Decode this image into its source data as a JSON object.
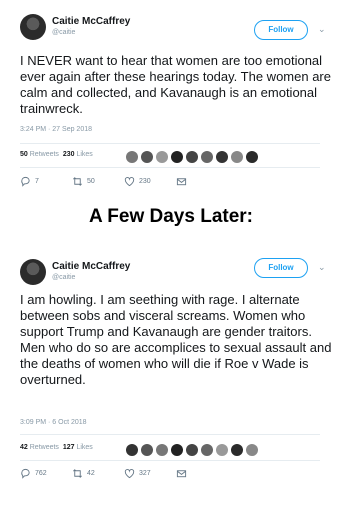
{
  "tweet1": {
    "name": "Caitie McCaffrey",
    "handle": "@caitie",
    "follow_label": "Follow",
    "text": "I NEVER want to hear that women are too emotional ever again after these hearings today.  The women are calm and collected, and Kavanaugh is an emotional trainwreck.",
    "timestamp": "3:24 PM · 27 Sep 2018",
    "retweets_count": "50",
    "retweets_label": "Retweets",
    "likes_count": "230",
    "likes_label": "Likes",
    "replies": "7",
    "retweets_action": "50",
    "likes_action": "230"
  },
  "headline": "A Few Days Later:",
  "tweet2": {
    "name": "Caitie McCaffrey",
    "handle": "@caitie",
    "follow_label": "Follow",
    "text": "I am howling.  I am seething with rage.  I alternate between sobs and visceral screams. Women who support Trump and Kavanaugh are gender traitors.  Men who do so are accomplices to sexual assault and the deaths of women who will die if Roe v Wade is overturned.",
    "timestamp": "3:09 PM · 6 Oct 2018",
    "retweets_count": "42",
    "retweets_label": "Retweets",
    "likes_count": "127",
    "likes_label": "Likes",
    "replies": "762",
    "retweets_action": "42",
    "likes_action": "327"
  }
}
